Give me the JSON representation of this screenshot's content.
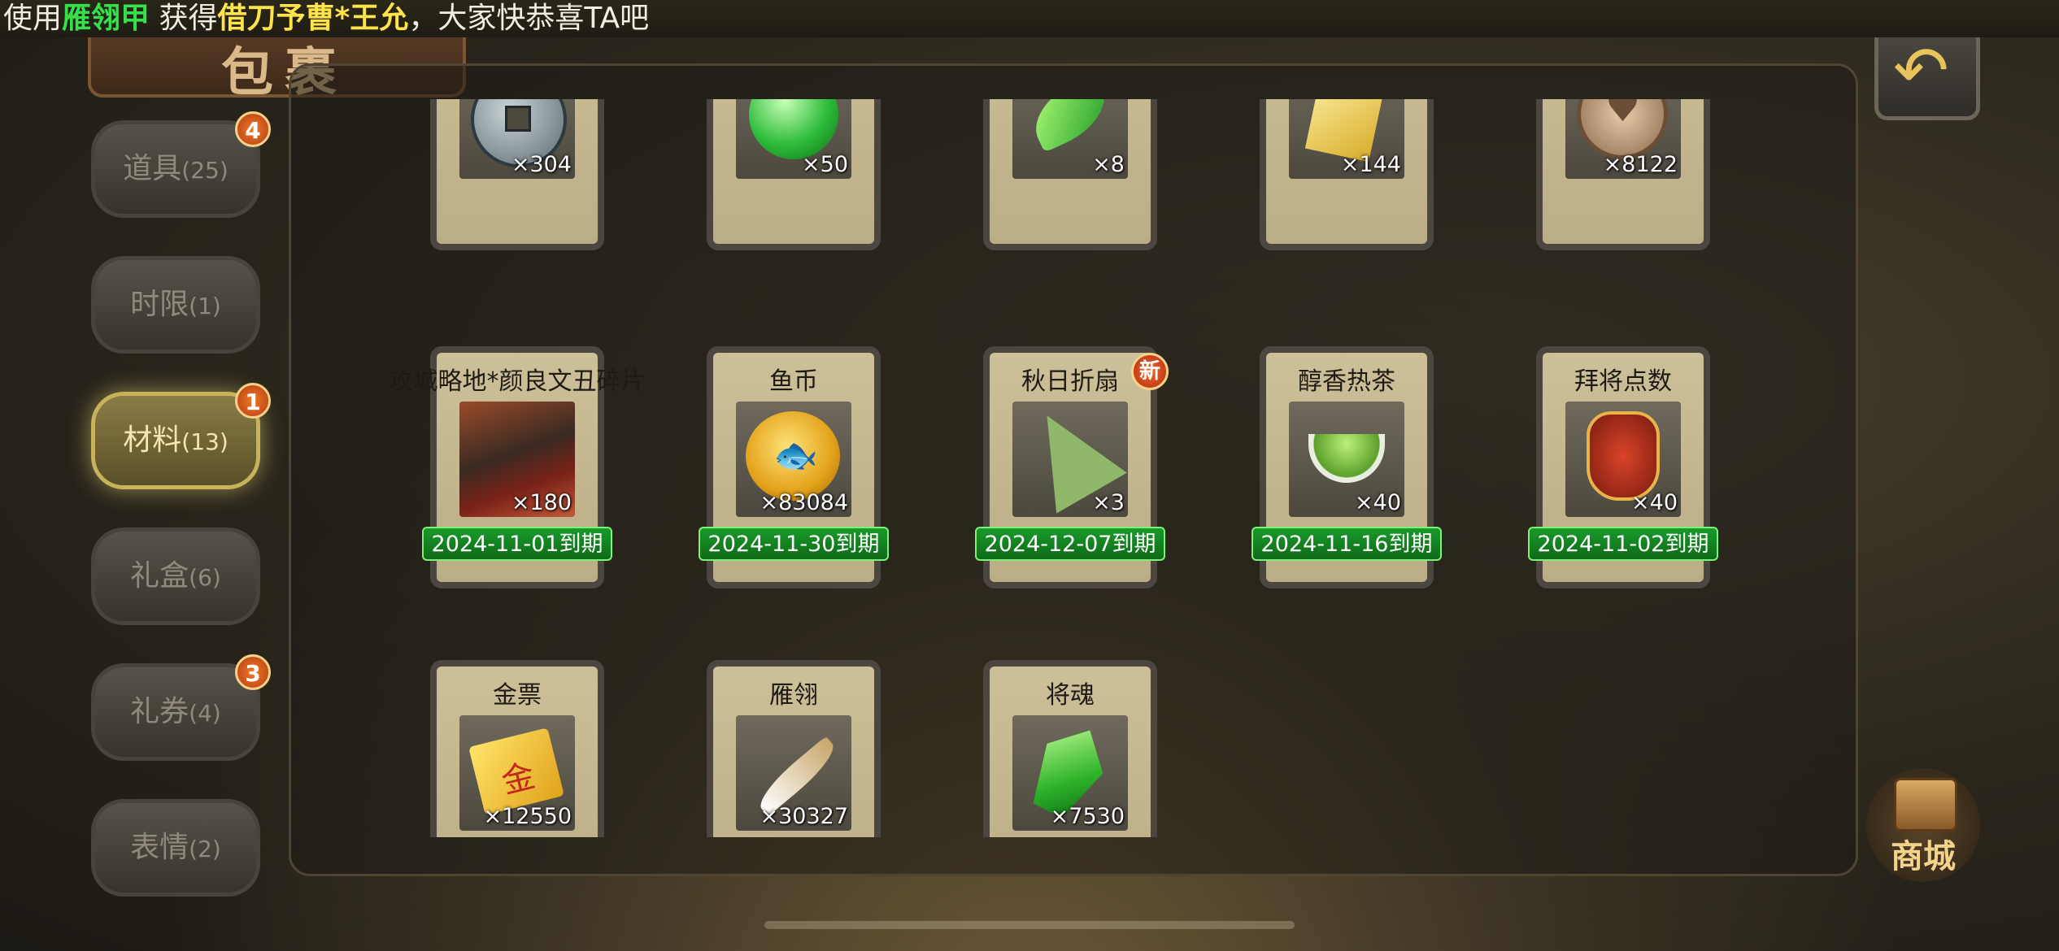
{
  "ticker": {
    "prefix": "使用",
    "item": "雁翎甲",
    "middle": " 获得",
    "reward": "借刀予曹*王允",
    "suffix": "，大家快恭喜TA吧"
  },
  "title": "包裹",
  "back_icon": "back-arrow-icon",
  "shop_label": "商城",
  "tabs": [
    {
      "label": "道具",
      "count": "(25)",
      "badge": "4",
      "active": false
    },
    {
      "label": "时限",
      "count": "(1)",
      "badge": "",
      "active": false
    },
    {
      "label": "材料",
      "count": "(13)",
      "badge": "1",
      "active": true
    },
    {
      "label": "礼盒",
      "count": "(6)",
      "badge": "",
      "active": false
    },
    {
      "label": "礼券",
      "count": "(4)",
      "badge": "3",
      "active": false
    },
    {
      "label": "表情",
      "count": "(2)",
      "badge": "",
      "active": false
    }
  ],
  "items_row1": [
    {
      "qty": "×304",
      "icon": "copper-coins-icon"
    },
    {
      "qty": "×50",
      "icon": "green-orb-icon"
    },
    {
      "qty": "×8",
      "icon": "jade-leaf-icon"
    },
    {
      "qty": "×144",
      "icon": "gold-paper-icon"
    },
    {
      "qty": "×8122",
      "icon": "heart-medal-icon"
    }
  ],
  "items_row2": [
    {
      "name": "攻城略地*颜良文丑碎片",
      "qty": "×180",
      "expire": "2024-11-01到期",
      "icon": "hero-portrait-icon",
      "new": ""
    },
    {
      "name": "鱼币",
      "qty": "×83084",
      "expire": "2024-11-30到期",
      "icon": "fish-coin-icon",
      "new": ""
    },
    {
      "name": "秋日折扇",
      "qty": "×3",
      "expire": "2024-12-07到期",
      "icon": "folding-fan-icon",
      "new": "新"
    },
    {
      "name": "醇香热茶",
      "qty": "×40",
      "expire": "2024-11-16到期",
      "icon": "tea-cup-icon",
      "new": ""
    },
    {
      "name": "拜将点数",
      "qty": "×40",
      "expire": "2024-11-02到期",
      "icon": "general-pouch-icon",
      "new": ""
    }
  ],
  "items_row3": [
    {
      "name": "金票",
      "qty": "×12550",
      "icon": "gold-ticket-icon"
    },
    {
      "name": "雁翎",
      "qty": "×30327",
      "icon": "feather-icon"
    },
    {
      "name": "将魂",
      "qty": "×7530",
      "icon": "soul-crystal-icon"
    }
  ]
}
